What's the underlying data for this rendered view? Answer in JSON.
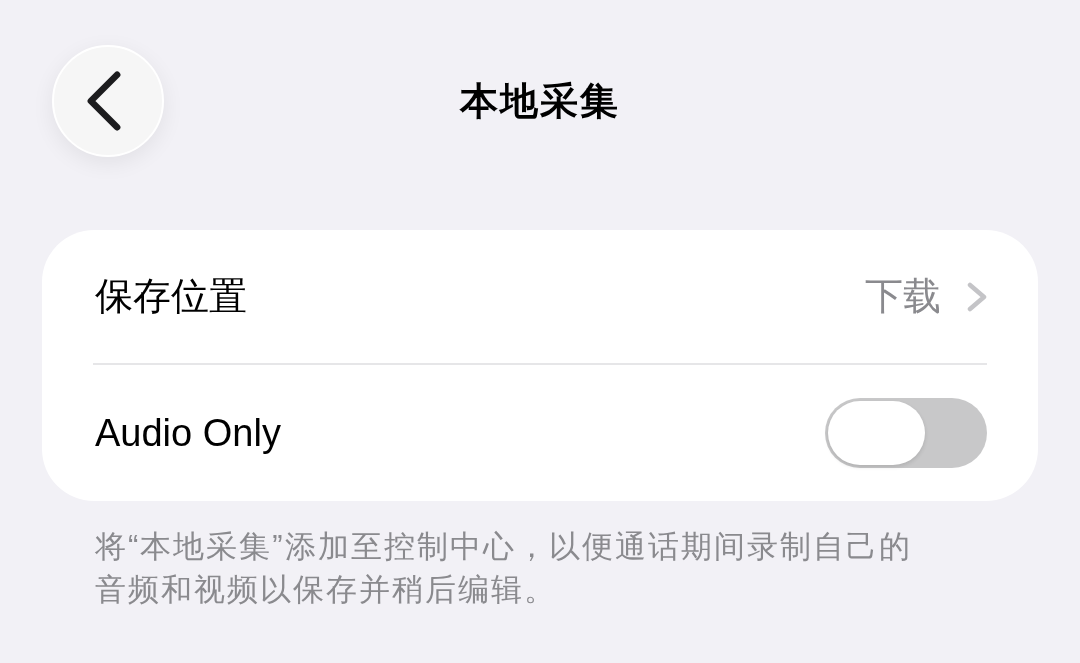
{
  "navigation": {
    "title": "本地采集"
  },
  "settings": [
    {
      "kind": "link",
      "label": "保存位置",
      "value": "下载"
    },
    {
      "kind": "toggle",
      "label": "Audio Only",
      "on": false
    }
  ],
  "footer_note": "将“本地采集”添加至控制中心，以便通话期间录制自己的音频和视频以保存并稍后编辑。"
}
